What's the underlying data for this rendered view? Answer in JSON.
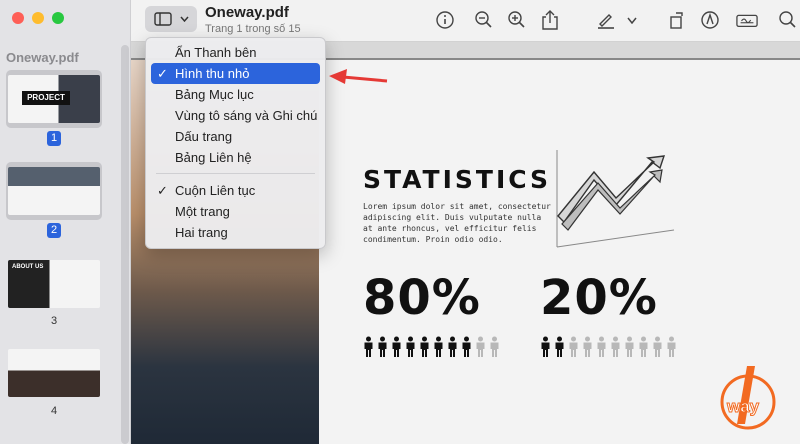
{
  "window": {
    "traffic_colors": [
      "#fe5f57",
      "#febc2e",
      "#28c840"
    ]
  },
  "sidebar": {
    "title": "Oneway.pdf",
    "thumbnails": [
      {
        "page": "1",
        "selected": true,
        "label": "PROJECT"
      },
      {
        "page": "2",
        "selected": true,
        "label": ""
      },
      {
        "page": "3",
        "selected": false,
        "label": "ABOUT US"
      },
      {
        "page": "4",
        "selected": false,
        "label": ""
      }
    ]
  },
  "toolbar": {
    "doc_title": "Oneway.pdf",
    "doc_subtitle": "Trang 1 trong số 15",
    "icons": [
      "sidebar-icon",
      "chevron-down-icon",
      "info-icon",
      "zoom-out-icon",
      "zoom-in-icon",
      "share-icon",
      "highlight-pen-icon",
      "chevron-down-icon",
      "rotate-icon",
      "markup-icon",
      "signature-icon",
      "search-icon"
    ]
  },
  "menu": {
    "items": [
      {
        "label": "Ẩn Thanh bên",
        "checked": false,
        "selected": false
      },
      {
        "label": "Hình thu nhỏ",
        "checked": true,
        "selected": true
      },
      {
        "label": "Bảng Mục lục",
        "checked": false,
        "selected": false
      },
      {
        "label": "Vùng tô sáng và Ghi chú",
        "checked": false,
        "selected": false
      },
      {
        "label": "Dấu trang",
        "checked": false,
        "selected": false
      },
      {
        "label": "Bảng Liên hệ",
        "checked": false,
        "selected": false
      }
    ],
    "items2": [
      {
        "label": "Cuộn Liên tục",
        "checked": true,
        "selected": false
      },
      {
        "label": "Một trang",
        "checked": false,
        "selected": false
      },
      {
        "label": "Hai trang",
        "checked": false,
        "selected": false
      }
    ],
    "check_glyph": "✓"
  },
  "document": {
    "heading": "STATISTICS",
    "body": "Lorem ipsum dolor sit amet, consectetur adipiscing elit. Duis vulputate nulla at ante rhoncus, vel efficitur felis condimentum. Proin odio odio.",
    "stat1": "80%",
    "stat2": "20%",
    "stat1_filled": 8,
    "stat2_filled": 2,
    "people_total": 10
  },
  "colors": {
    "accent": "#2c64dc",
    "arrow": "#e53935",
    "logo": "#f26a21"
  },
  "logo_text": "way"
}
